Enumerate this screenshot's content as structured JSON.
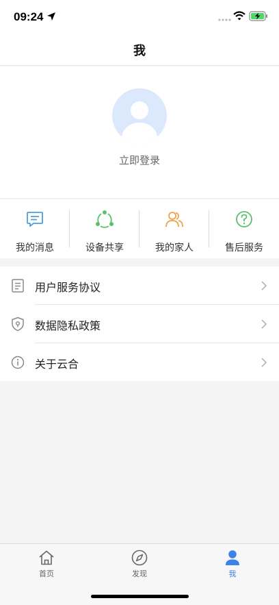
{
  "status_bar": {
    "time": "09:24"
  },
  "nav": {
    "title": "我"
  },
  "profile": {
    "login_label": "立即登录"
  },
  "quick_actions": [
    {
      "label": "我的消息",
      "icon": "message-icon",
      "color": "#4a9fe0"
    },
    {
      "label": "设备共享",
      "icon": "share-icon",
      "color": "#5cc06a"
    },
    {
      "label": "我的家人",
      "icon": "family-icon",
      "color": "#f0a04b"
    },
    {
      "label": "售后服务",
      "icon": "help-icon",
      "color": "#5cc06a"
    }
  ],
  "menu": [
    {
      "label": "用户服务协议",
      "icon": "document-icon"
    },
    {
      "label": "数据隐私政策",
      "icon": "shield-icon"
    },
    {
      "label": "关于云合",
      "icon": "info-icon"
    }
  ],
  "tabs": [
    {
      "label": "首页",
      "icon": "home-icon",
      "active": false
    },
    {
      "label": "发现",
      "icon": "compass-icon",
      "active": false
    },
    {
      "label": "我",
      "icon": "person-icon",
      "active": true
    }
  ],
  "colors": {
    "accent": "#3d82e6",
    "avatar_bg": "#dce8fb"
  }
}
